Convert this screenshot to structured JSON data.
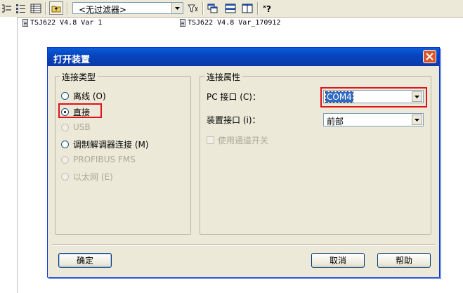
{
  "toolbar": {
    "filter_value": "<无过滤器>",
    "icons": [
      "tree-view-icon",
      "list-view-icon",
      "details-view-icon",
      "up-folder-icon",
      "filter-icon",
      "window-icon",
      "tile-icon",
      "columns-icon",
      "help-icon"
    ]
  },
  "tree": {
    "items": [
      "TSJ622 V4.8 Var 1",
      "TSJ622 V4.8 Var_170912"
    ]
  },
  "dialog": {
    "title": "打开装置",
    "connection_type": {
      "label": "连接类型",
      "options": [
        {
          "label": "离线 (O)",
          "checked": false,
          "enabled": true
        },
        {
          "label": "直接",
          "checked": true,
          "enabled": true
        },
        {
          "label": "USB",
          "checked": false,
          "enabled": false
        },
        {
          "label": "调制解调器连接 (M)",
          "checked": false,
          "enabled": true
        },
        {
          "label": "PROFIBUS FMS",
          "checked": false,
          "enabled": false
        },
        {
          "label": "以太网 (E)",
          "checked": false,
          "enabled": false
        }
      ]
    },
    "connection_props": {
      "label": "连接属性",
      "pc_port_label": "PC 接口 (C)：",
      "pc_port_value": "COM4",
      "device_port_label": "装置接口 (i)：",
      "device_port_value": "前部",
      "checkbox_label": "使用通道开关"
    },
    "buttons": {
      "ok": "确定",
      "cancel": "取消",
      "help": "帮助"
    }
  },
  "colors": {
    "highlight": "#e0141c",
    "title_bar": "#0a4fd0",
    "dialog_bg": "#ece9d8"
  }
}
